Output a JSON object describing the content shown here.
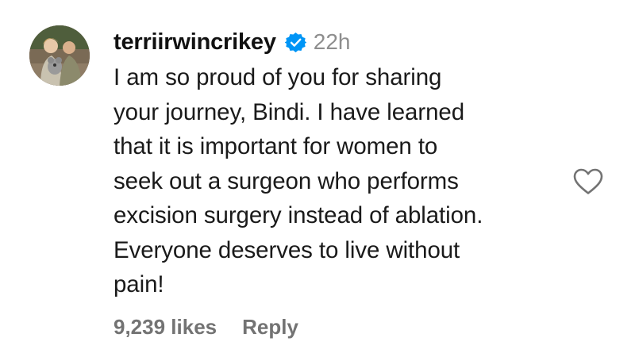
{
  "comment": {
    "username": "terriirwincrikey",
    "verified_icon": "verified-badge-icon",
    "timestamp": "22h",
    "text_lines": [
      "I am so proud of you for sharing",
      "your journey, Bindi. I have learned",
      "that it is important for women to",
      "seek out a surgeon who performs",
      "excision surgery instead of ablation.",
      "Everyone deserves to live without",
      "pain!"
    ],
    "likes": "9,239 likes",
    "reply_label": "Reply",
    "like_icon": "heart-icon"
  },
  "colors": {
    "verified": "#0095f6",
    "muted": "#737373",
    "timestamp": "#8e8e8e",
    "text": "#1a1a1a"
  }
}
